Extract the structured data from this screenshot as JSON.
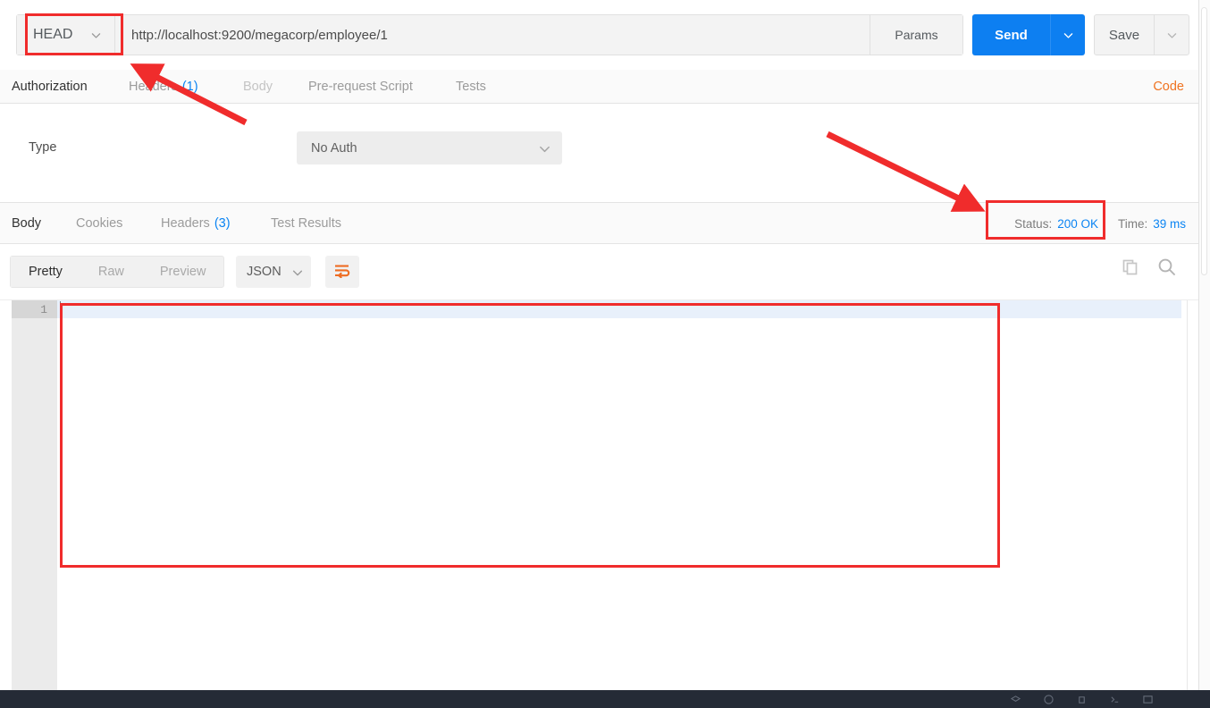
{
  "request": {
    "method": "HEAD",
    "url_value": "http://localhost:9200/megacorp/employee/1",
    "url_placeholder": "Enter request URL",
    "params_label": "Params",
    "send_label": "Send",
    "save_label": "Save",
    "method_caret_icon": "chevron-down-icon",
    "send_caret_icon": "chevron-down-icon",
    "save_caret_icon": "chevron-down-icon"
  },
  "request_tabs": {
    "items": [
      {
        "label": "Authorization",
        "count": "",
        "active": true,
        "dim": false
      },
      {
        "label": "Headers",
        "count": "(1)",
        "active": false,
        "dim": false
      },
      {
        "label": "Body",
        "count": "",
        "active": false,
        "dim": true
      },
      {
        "label": "Pre-request Script",
        "count": "",
        "active": false,
        "dim": false
      },
      {
        "label": "Tests",
        "count": "",
        "active": false,
        "dim": false
      }
    ],
    "code_label": "Code"
  },
  "auth": {
    "type_label": "Type",
    "type_value": "No Auth",
    "caret_icon": "chevron-down-icon"
  },
  "response_tabs": {
    "items": [
      {
        "label": "Body",
        "count": "",
        "active": true
      },
      {
        "label": "Cookies",
        "count": "",
        "active": false
      },
      {
        "label": "Headers",
        "count": "(3)",
        "active": false
      },
      {
        "label": "Test Results",
        "count": "",
        "active": false
      }
    ],
    "status_label": "Status:",
    "status_value": "200 OK",
    "time_label": "Time:",
    "time_value": "39 ms"
  },
  "viewer": {
    "modes": [
      {
        "label": "Pretty",
        "active": true
      },
      {
        "label": "Raw",
        "active": false
      },
      {
        "label": "Preview",
        "active": false
      }
    ],
    "format_value": "JSON",
    "format_caret_icon": "chevron-down-icon",
    "wrap_icon": "word-wrap-icon",
    "copy_icon": "copy-icon",
    "search_icon": "search-icon"
  },
  "body": {
    "line_numbers": [
      "1"
    ],
    "lines": [
      ""
    ]
  },
  "colors": {
    "accent_orange": "#f07321",
    "link_blue": "#0b84f3",
    "send_blue": "#0d7ff1",
    "annotation_red": "#f02c2c",
    "footer_dark": "#252b36"
  },
  "annotations": {
    "method_highlight": "red-box-around-method-selector",
    "status_highlight": "red-box-around-status",
    "body_highlight": "red-box-around-empty-response-body",
    "arrow_to_headers": "red-arrow-pointing-to-request-headers-tab",
    "arrow_to_status": "red-arrow-pointing-to-status"
  }
}
